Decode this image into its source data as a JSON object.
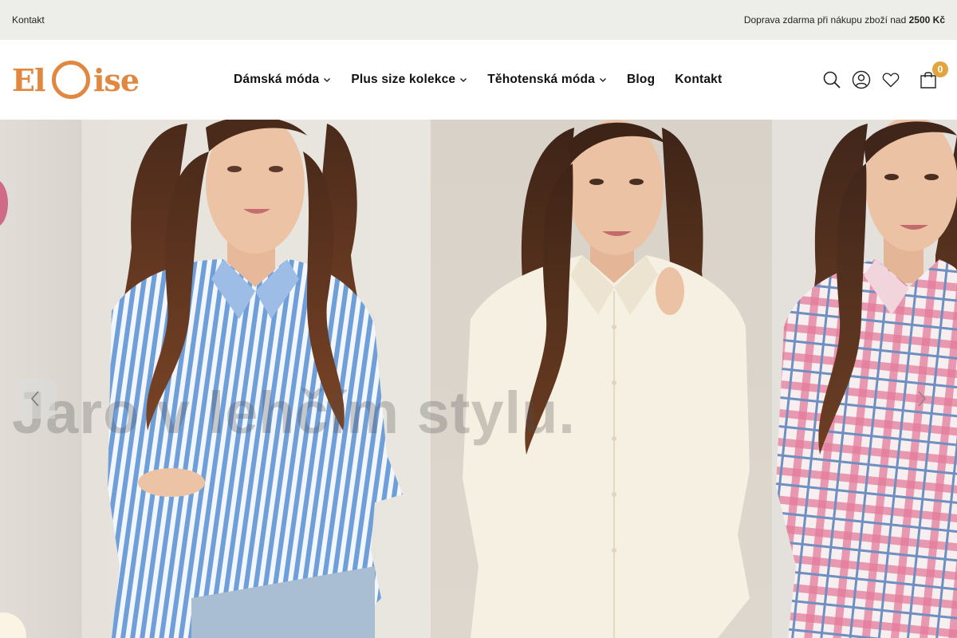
{
  "topbar": {
    "contact_link": "Kontakt",
    "promo_text": "Doprava zdarma při nákupu zboží nad",
    "promo_amount": "2500 Kč"
  },
  "logo": {
    "part1": "El",
    "part2": "ise",
    "brand": "Eloise",
    "color": "#e2873f"
  },
  "nav": {
    "items": [
      {
        "label": "Dámská móda",
        "has_dropdown": true
      },
      {
        "label": "Plus size kolekce",
        "has_dropdown": true
      },
      {
        "label": "Těhotenská móda",
        "has_dropdown": true
      },
      {
        "label": "Blog",
        "has_dropdown": false
      },
      {
        "label": "Kontakt",
        "has_dropdown": false
      }
    ]
  },
  "header_icons": {
    "search": "search-icon",
    "account": "user-icon",
    "wishlist": "heart-icon",
    "cart": "shopping-bag-icon",
    "cart_count": "0",
    "badge_color": "#e2a43f"
  },
  "hero": {
    "headline": "Jaro v lehčím stylu.",
    "panels": [
      {
        "description": "Blue and white striped oversized shirt"
      },
      {
        "description": "Cream oversized shirt"
      },
      {
        "description": "Pink and blue plaid flannel shirt"
      }
    ]
  }
}
